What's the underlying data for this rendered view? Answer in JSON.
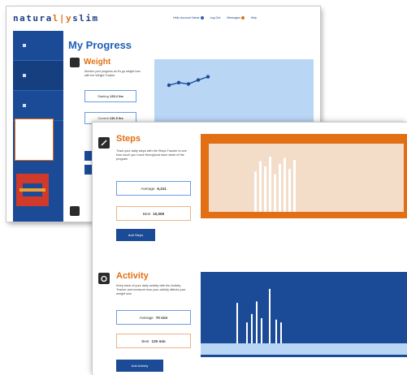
{
  "brand": {
    "logo_left": "natura",
    "logo_sep": "l|y",
    "logo_right": "slim"
  },
  "top_nav": [
    "Hello Account Name",
    "Log Out",
    "Messages",
    "Help"
  ],
  "progress": {
    "title": "My Progress",
    "weight": {
      "title": "Weight",
      "description": "Monitor your progress as it's go weight loss with the Weight Tracker",
      "starting_label": "Starting",
      "starting_value": "135.2 lbs",
      "current_label": "Current",
      "current_value": "136.5 lbs",
      "chart_values": [
        0.6,
        0.64,
        0.62,
        0.68,
        0.73
      ]
    }
  },
  "steps": {
    "title": "Steps",
    "description": "Track your daily steps with the Steps Tracker to see how much you move throughout each week of the program",
    "average_label": "Average",
    "average_value": "6,211",
    "best_label": "Best",
    "best_value": "10,009",
    "button": "Add Steps",
    "chart_values": [
      0.62,
      0.78,
      0.7,
      0.85,
      0.58,
      0.74,
      0.83,
      0.66,
      0.8
    ]
  },
  "activity": {
    "title": "Activity",
    "description": "Keep track of your daily activity with the Activity Tracker and measure how your activity affects your weight loss",
    "average_label": "Average",
    "average_value": "70 min",
    "best_label": "Best",
    "best_value": "120 min",
    "button": "Add Activity",
    "chart_values": [
      0.58,
      0.3,
      0.42,
      0.6,
      0.36,
      0.78,
      0.34,
      0.3
    ]
  },
  "colors": {
    "blue": "#1b4b97",
    "light_blue": "#b9d6f5",
    "orange": "#e36f14",
    "steps_chart_bg": "#f3dcc8"
  }
}
